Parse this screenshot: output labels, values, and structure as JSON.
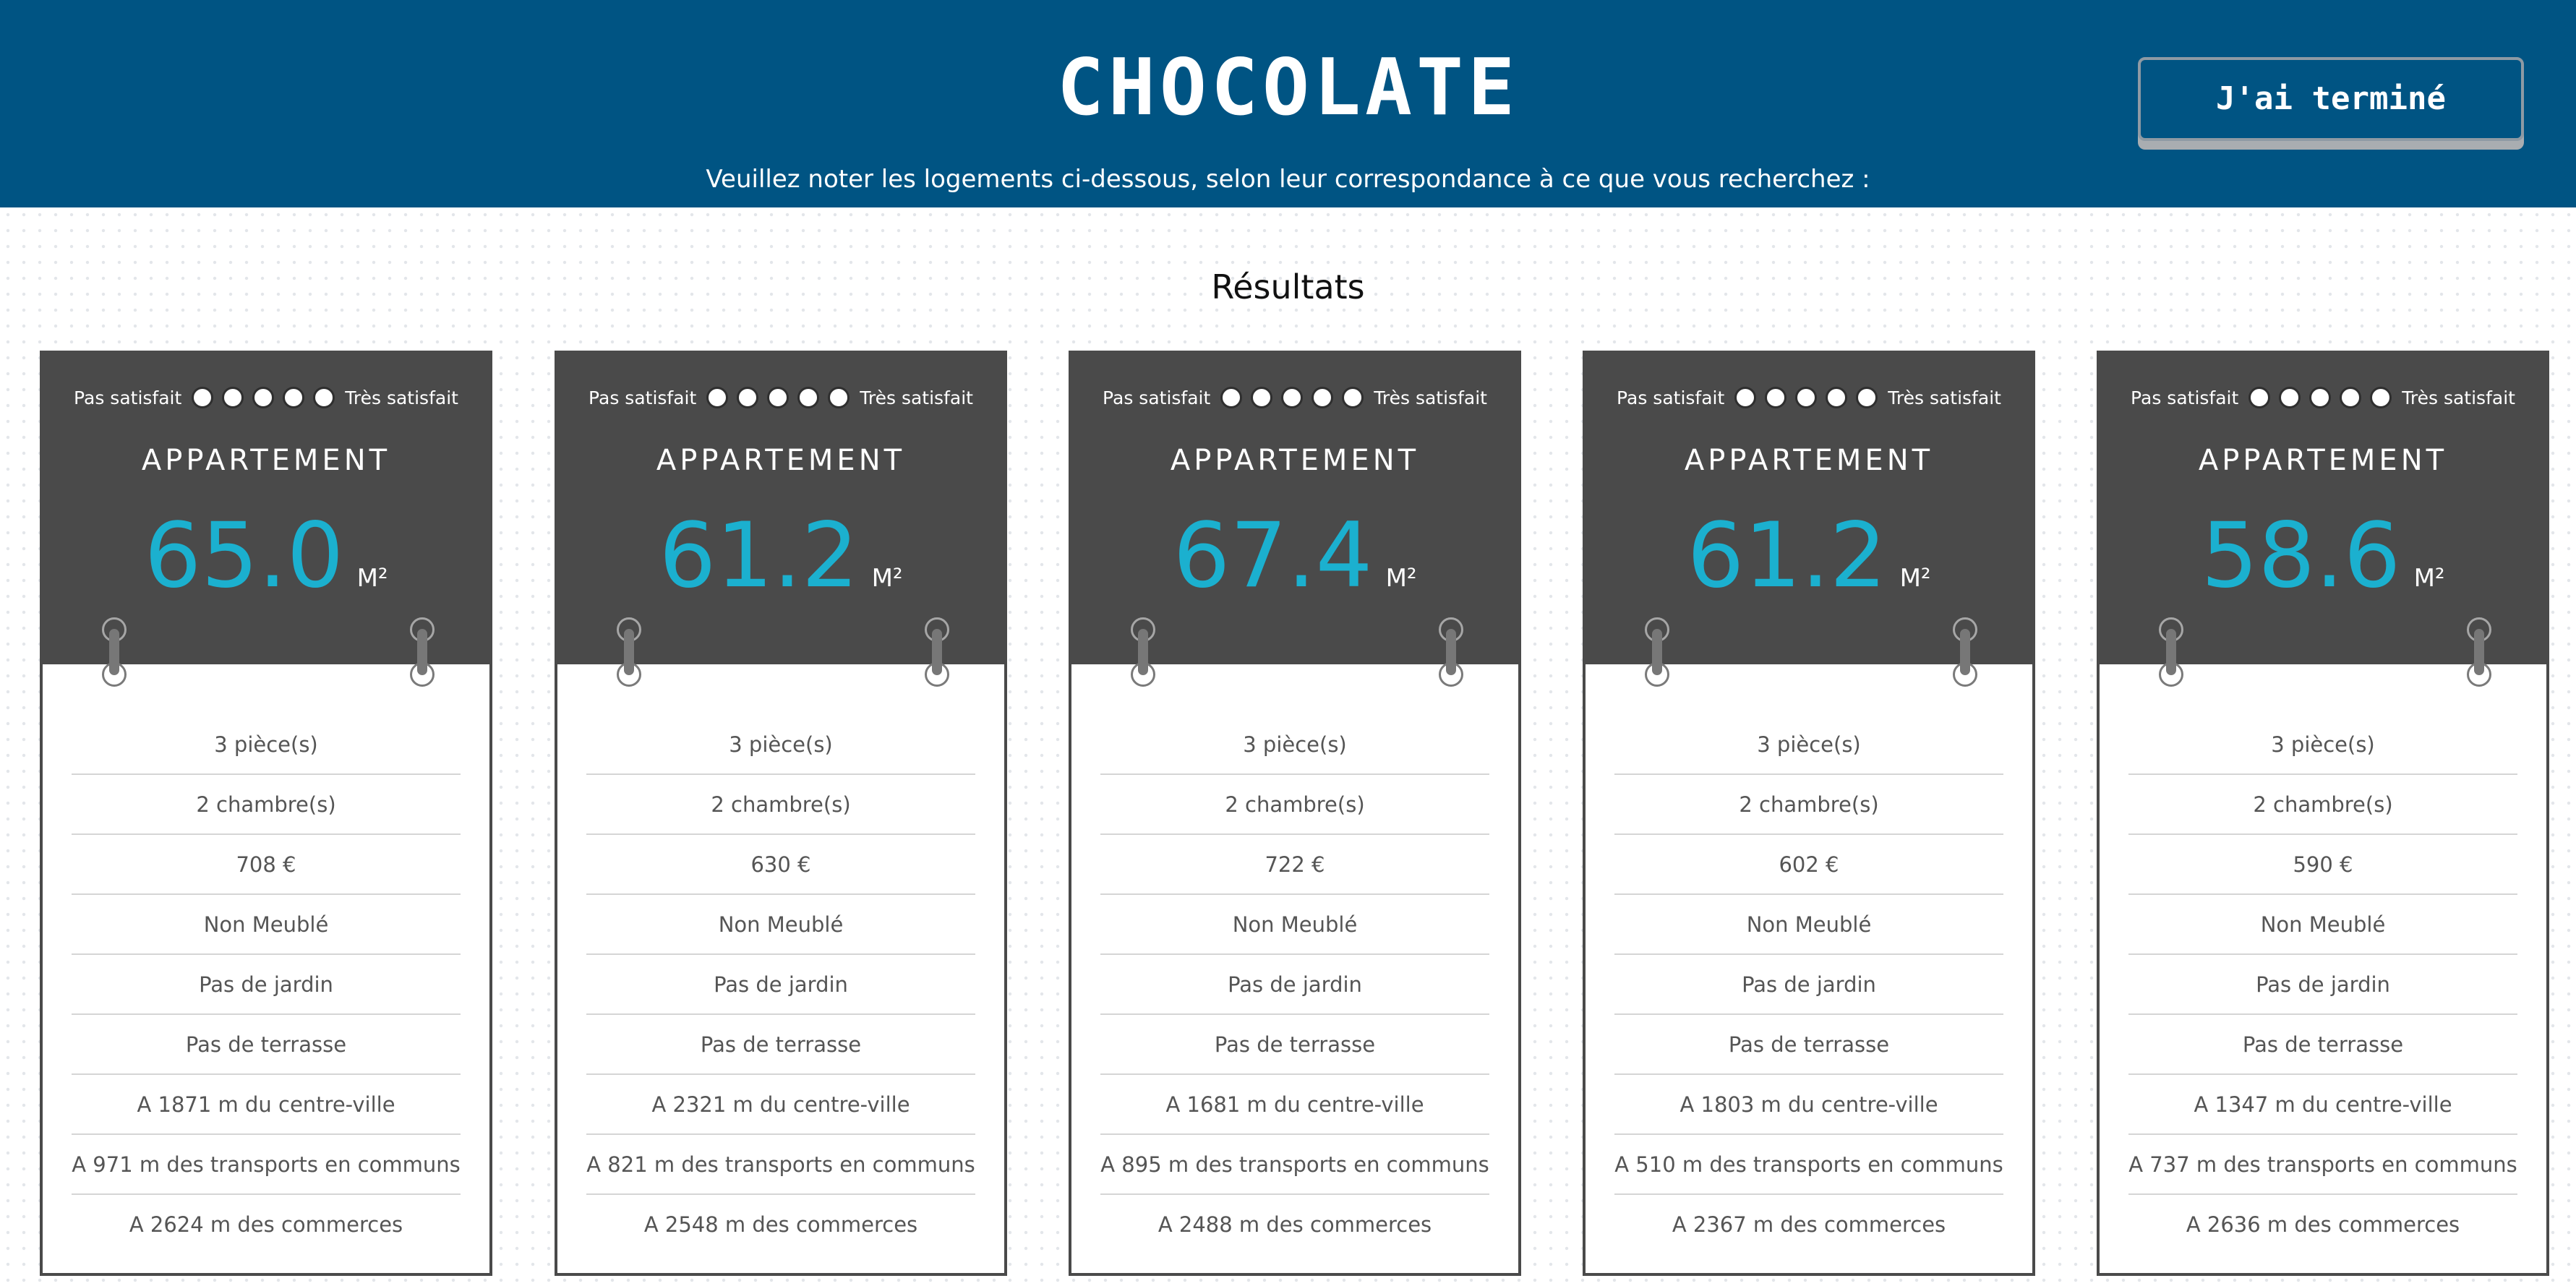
{
  "header": {
    "title": "CHOCOLATE",
    "subtitle": "Veuillez noter les logements ci-dessous, selon leur correspondance à ce que vous recherchez :",
    "done_label": "J'ai terminé",
    "background_color": "#005483"
  },
  "results": {
    "heading": "Résultats",
    "rating_low_label": "Pas satisfait",
    "rating_high_label": "Très satisfait",
    "area_unit": "M²",
    "accent_color": "#1bb0cf",
    "cards": [
      {
        "type": "APPARTEMENT",
        "area": "65.0",
        "features": [
          "3 pièce(s)",
          "2 chambre(s)",
          "708 €",
          "Non Meublé",
          "Pas de jardin",
          "Pas de terrasse",
          "A 1871 m du centre-ville",
          "A 971 m des transports en communs",
          "A 2624 m des commerces"
        ]
      },
      {
        "type": "APPARTEMENT",
        "area": "61.2",
        "features": [
          "3 pièce(s)",
          "2 chambre(s)",
          "630 €",
          "Non Meublé",
          "Pas de jardin",
          "Pas de terrasse",
          "A 2321 m du centre-ville",
          "A 821 m des transports en communs",
          "A 2548 m des commerces"
        ]
      },
      {
        "type": "APPARTEMENT",
        "area": "67.4",
        "features": [
          "3 pièce(s)",
          "2 chambre(s)",
          "722 €",
          "Non Meublé",
          "Pas de jardin",
          "Pas de terrasse",
          "A 1681 m du centre-ville",
          "A 895 m des transports en communs",
          "A 2488 m des commerces"
        ]
      },
      {
        "type": "APPARTEMENT",
        "area": "61.2",
        "features": [
          "3 pièce(s)",
          "2 chambre(s)",
          "602 €",
          "Non Meublé",
          "Pas de jardin",
          "Pas de terrasse",
          "A 1803 m du centre-ville",
          "A 510 m des transports en communs",
          "A 2367 m des commerces"
        ]
      },
      {
        "type": "APPARTEMENT",
        "area": "58.6",
        "features": [
          "3 pièce(s)",
          "2 chambre(s)",
          "590 €",
          "Non Meublé",
          "Pas de jardin",
          "Pas de terrasse",
          "A 1347 m du centre-ville",
          "A 737 m des transports en communs",
          "A 2636 m des commerces"
        ]
      }
    ]
  }
}
